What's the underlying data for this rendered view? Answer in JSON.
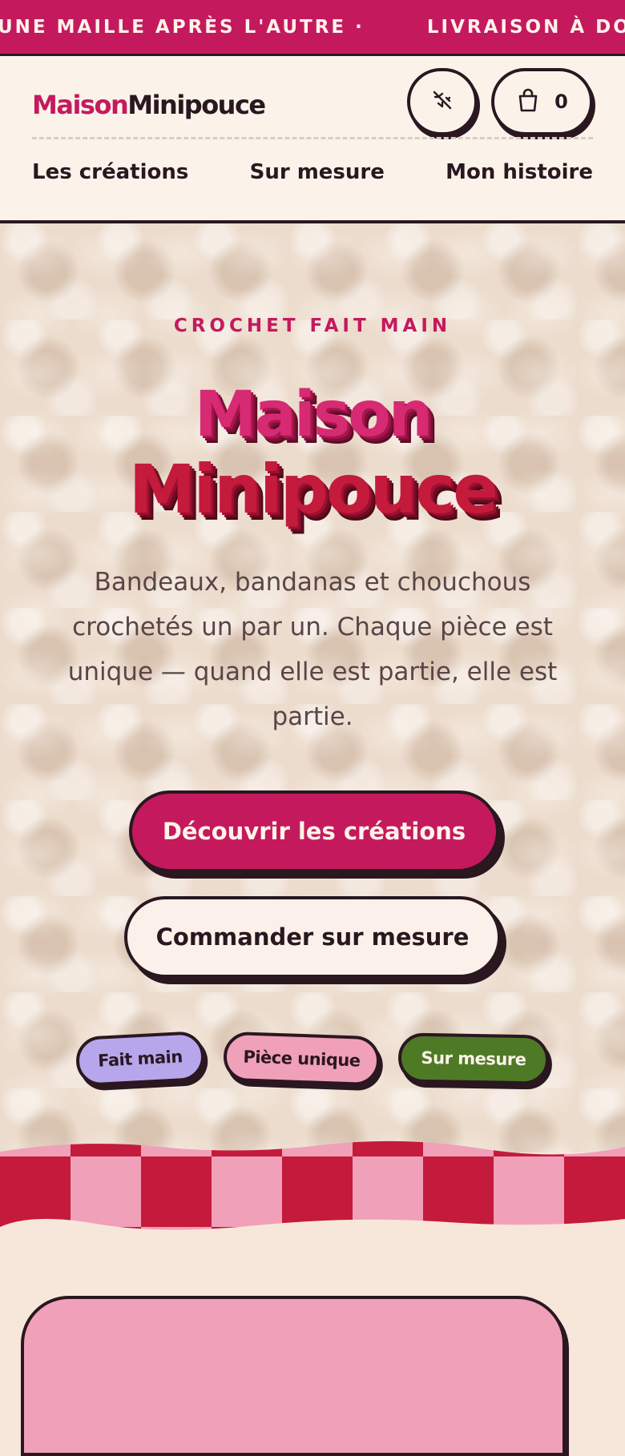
{
  "marquee": {
    "items": [
      "UNE MAILLE APRÈS L'AUTRE ·",
      "LIVRAISON À DO"
    ]
  },
  "header": {
    "logo_part1": "Maison",
    "logo_part2": "Minipouce",
    "sound_icon": "sound-off-icon",
    "cart_icon": "shopping-bag-icon",
    "cart_count": "0",
    "nav": [
      "Les créations",
      "Sur mesure",
      "Mon histoire"
    ]
  },
  "hero": {
    "eyebrow": "CROCHET FAIT MAIN",
    "title_line1": "Maison",
    "title_line2": "Minipouce",
    "lead": "Bandeaux, bandanas et chouchous crochetés un par un. Chaque pièce est unique — quand elle est partie, elle est partie.",
    "cta_primary": "Découvrir les créations",
    "cta_secondary": "Commander sur mesure",
    "tags": [
      "Fait main",
      "Pièce unique",
      "Sur mesure"
    ]
  },
  "colors": {
    "brand": "#c41a5d",
    "ink": "#2a1720",
    "cream": "#fbf3ea",
    "check_red": "#c41a3c",
    "check_pink": "#f0a0b8",
    "tag_lilac": "#b8a6ec",
    "tag_green": "#4e7a26"
  }
}
